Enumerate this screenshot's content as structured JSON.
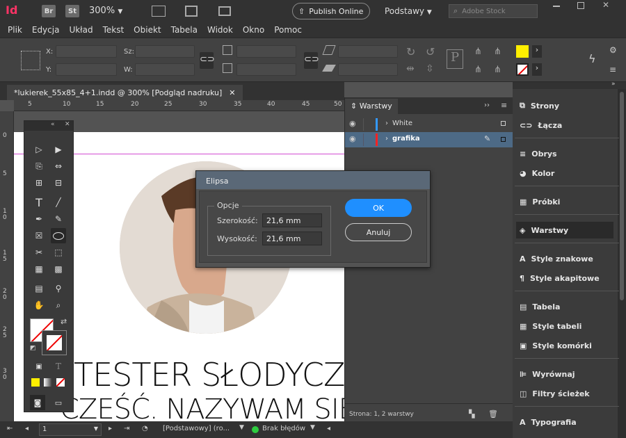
{
  "app": {
    "logo": "Id",
    "br": "Br",
    "st": "St",
    "zoom": "300%",
    "publish": "Publish Online",
    "workspace": "Podstawy",
    "search_placeholder": "Adobe Stock"
  },
  "menu": [
    "Plik",
    "Edycja",
    "Układ",
    "Tekst",
    "Obiekt",
    "Tabela",
    "Widok",
    "Okno",
    "Pomoc"
  ],
  "control": {
    "x_label": "X:",
    "y_label": "Y:",
    "w_label": "Sz:",
    "h_label": "W:"
  },
  "document": {
    "tab_title": "*lukierek_55x85_4+1.indd @ 300% [Podgląd nadruku]",
    "heading1": "TESTER SŁODYCZY",
    "heading2": "CZEŚĆ. NAZYWAM SIĘ"
  },
  "ruler_h": [
    "5",
    "10",
    "15",
    "20",
    "25",
    "30",
    "35",
    "40",
    "45",
    "50"
  ],
  "ruler_v": [
    "0",
    "5",
    "1 0",
    "1 5",
    "2 0",
    "2 5",
    "3 0"
  ],
  "layers": {
    "title": "Warstwy",
    "items": [
      {
        "name": "White",
        "color": "#3399ff"
      },
      {
        "name": "grafika",
        "color": "#ff2222"
      }
    ],
    "footer": "Strona: 1, 2 warstwy"
  },
  "right_panel": [
    "Strony",
    "Łącza",
    "Obrys",
    "Kolor",
    "Próbki",
    "Warstwy",
    "Style znakowe",
    "Style akapitowe",
    "Tabela",
    "Style tabeli",
    "Style komórki",
    "Wyrównaj",
    "Filtry ścieżek",
    "Typografia"
  ],
  "dialog": {
    "title": "Elipsa",
    "group": "Opcje",
    "width_label": "Szerokość:",
    "width_value": "21,6 mm",
    "height_label": "Wysokość:",
    "height_value": "21,6 mm",
    "ok": "OK",
    "cancel": "Anuluj"
  },
  "status": {
    "page": "1",
    "style": "[Podstawowy] (ro...",
    "errors": "Brak błędów"
  }
}
